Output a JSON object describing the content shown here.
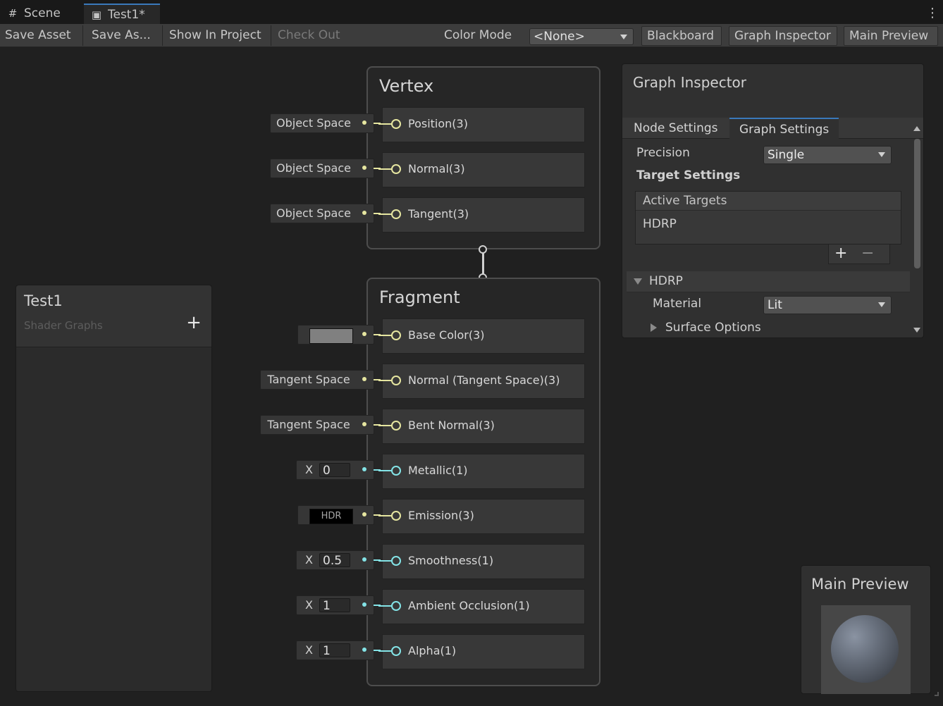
{
  "tabs": [
    {
      "label": "Scene",
      "icon": "grid-icon"
    },
    {
      "label": "Test1*",
      "icon": "shader-graph-icon"
    }
  ],
  "toolbar": {
    "save_asset": "Save Asset",
    "save_as": "Save As...",
    "show_in_project": "Show In Project",
    "check_out": "Check Out",
    "color_mode_label": "Color Mode",
    "color_mode_value": "<None>",
    "blackboard": "Blackboard",
    "graph_inspector": "Graph Inspector",
    "main_preview": "Main Preview"
  },
  "blackboard": {
    "title": "Test1",
    "subtitle": "Shader Graphs",
    "add_icon": "+"
  },
  "vertex": {
    "title": "Vertex",
    "blocks": [
      {
        "label": "Position(3)",
        "port": "Object Space"
      },
      {
        "label": "Normal(3)",
        "port": "Object Space"
      },
      {
        "label": "Tangent(3)",
        "port": "Object Space"
      }
    ]
  },
  "fragment": {
    "title": "Fragment",
    "blocks": [
      {
        "label": "Base Color(3)",
        "port_color": "#808080"
      },
      {
        "label": "Normal (Tangent Space)(3)",
        "port": "Tangent Space"
      },
      {
        "label": "Bent Normal(3)",
        "port": "Tangent Space"
      },
      {
        "label": "Metallic(1)",
        "axis": "X",
        "value": "0"
      },
      {
        "label": "Emission(3)",
        "port": "HDR"
      },
      {
        "label": "Smoothness(1)",
        "axis": "X",
        "value": "0.5"
      },
      {
        "label": "Ambient Occlusion(1)",
        "axis": "X",
        "value": "1"
      },
      {
        "label": "Alpha(1)",
        "axis": "X",
        "value": "1"
      }
    ]
  },
  "inspector": {
    "title": "Graph Inspector",
    "tabs": [
      "Node Settings",
      "Graph Settings"
    ],
    "active_tab": "Graph Settings",
    "precision_label": "Precision",
    "precision_value": "Single",
    "target_settings": "Target Settings",
    "active_targets": "Active Targets",
    "targets": [
      "HDRP"
    ],
    "add_label": "+",
    "remove_label": "−",
    "section": "HDRP",
    "material_label": "Material",
    "material_value": "Lit",
    "surface_options": "Surface Options"
  },
  "preview": {
    "title": "Main Preview"
  },
  "colors": {
    "vector3_port": "#e6e6a0",
    "float_port": "#84e4e7",
    "accent": "#3a79bb"
  }
}
